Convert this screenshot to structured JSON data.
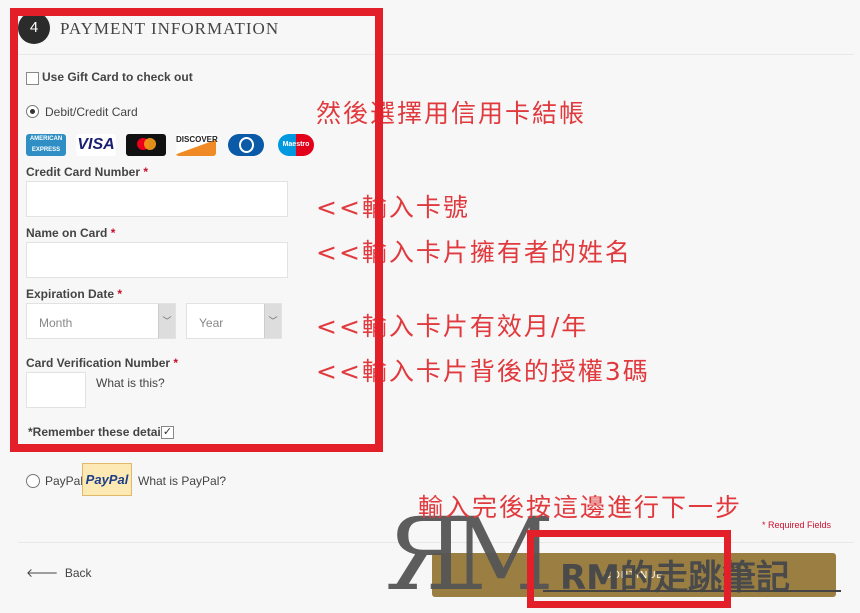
{
  "section": {
    "step": "4",
    "title": "PAYMENT INFORMATION"
  },
  "gift_card": {
    "label": "Use Gift Card to check out",
    "checked": false
  },
  "debit_credit": {
    "label": "Debit/Credit Card",
    "selected": true
  },
  "card_logos": [
    "AMERICAN EXPRESS",
    "VISA",
    "mastercard",
    "DISCOVER",
    "Diners Club",
    "Maestro"
  ],
  "fields": {
    "card_number": {
      "label": "Credit Card Number",
      "required": "*",
      "value": ""
    },
    "name_on_card": {
      "label": "Name on Card",
      "required": "*",
      "value": ""
    },
    "expiration": {
      "label": "Expiration Date",
      "required": "*",
      "month": "Month",
      "year": "Year"
    },
    "cvv": {
      "label": "Card Verification Number",
      "required": "*",
      "help": "What is this?",
      "value": ""
    }
  },
  "remember": {
    "label": "*Remember these details",
    "checked": true
  },
  "paypal": {
    "label": "PayPal",
    "logo": "PayPal",
    "help": "What is PayPal?",
    "selected": false
  },
  "required_note": "* Required Fields",
  "back_label": "Back",
  "continue_label": "CONTINUE",
  "annotations": {
    "choose_card": "然後選擇用信用卡結帳",
    "card_number": "<<輸入卡號",
    "name": "<<輸入卡片擁有者的姓名",
    "expiry": "<<輸入卡片有效月/年",
    "cvv": "<<輸入卡片背後的授權3碼",
    "next": "輸入完後按這邊進行下一步"
  },
  "watermark": {
    "logo": "RM",
    "text": "RM的走跳筆記"
  },
  "colors": {
    "accent": "#9b7f42",
    "highlight": "#e3202a",
    "annotation": "#e03a3e"
  }
}
